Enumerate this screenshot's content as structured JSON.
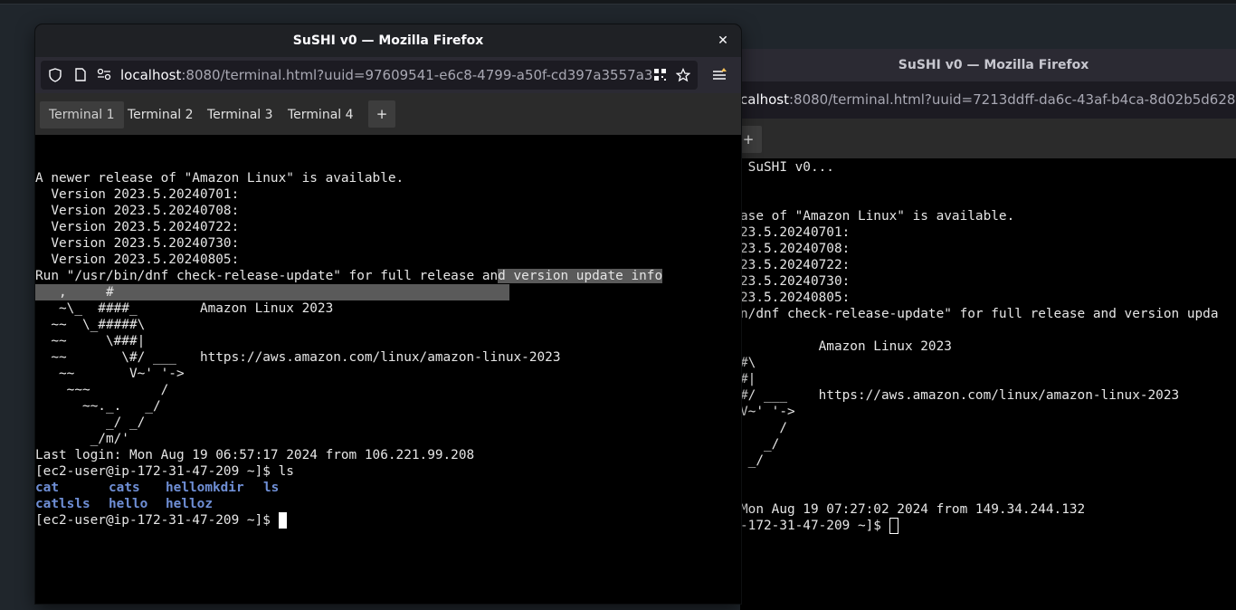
{
  "back_window": {
    "title": "SuSHI v0 — Mozilla Firefox",
    "url_host": "calhost",
    "url_rest": ":8080/terminal.html?uuid=7213ddff-da6c-43af-b4ca-8d02b5d628a",
    "tab_add_label": "+",
    "terminal_lines": [
      " SuSHI v0...",
      "",
      "",
      "ase of \"Amazon Linux\" is available.",
      "23.5.20240701:",
      "23.5.20240708:",
      "23.5.20240722:",
      "23.5.20240730:",
      "23.5.20240805:",
      "n/dnf check-release-update\" for full release and version upda",
      "",
      "          Amazon Linux 2023",
      "#\\",
      "#|",
      "#/ ___    https://aws.amazon.com/linux/amazon-linux-2023",
      "V~' '->",
      "     /",
      "   _/",
      " _/",
      "",
      "",
      "Mon Aug 19 07:27:02 2024 from 149.34.244.132",
      "-172-31-47-209 ~]$ "
    ]
  },
  "front_window": {
    "title": "SuSHI v0 — Mozilla Firefox",
    "url_host": "localhost",
    "url_rest": ":8080/terminal.html?uuid=97609541-e6c8-4799-a50f-cd397a3557a3",
    "tabs": [
      {
        "label": "Terminal 1",
        "active": true
      },
      {
        "label": "Terminal 2",
        "active": false
      },
      {
        "label": "Terminal 3",
        "active": false
      },
      {
        "label": "Terminal 4",
        "active": false
      }
    ],
    "tab_add_label": "+",
    "terminal_lines": [
      "",
      "",
      "A newer release of \"Amazon Linux\" is available.",
      "  Version 2023.5.20240701:",
      "  Version 2023.5.20240708:",
      "  Version 2023.5.20240722:",
      "  Version 2023.5.20240730:",
      "  Version 2023.5.20240805:",
      "Run \"/usr/bin/dnf check-release-update\" for full release an",
      "   ,     #",
      "   ~\\_  ####_        Amazon Linux 2023",
      "  ~~  \\_#####\\",
      "  ~~     \\###|",
      "  ~~       \\#/ ___   https://aws.amazon.com/linux/amazon-linux-2023",
      "   ~~       V~' '->",
      "    ~~~         /",
      "      ~~._.   _/",
      "         _/ _/",
      "       _/m/'",
      "Last login: Mon Aug 19 06:57:17 2024 from 106.221.99.208",
      "[ec2-user@ip-172-31-47-209 ~]$ ls",
      "",
      "",
      "[ec2-user@ip-172-31-47-209 ~]$ "
    ],
    "selected_tail": "d version update info",
    "ls_output_row1": [
      "cat",
      "cats",
      "hellomkdir",
      "ls"
    ],
    "ls_output_row2": [
      "catlsls",
      "hello",
      "helloz"
    ]
  }
}
